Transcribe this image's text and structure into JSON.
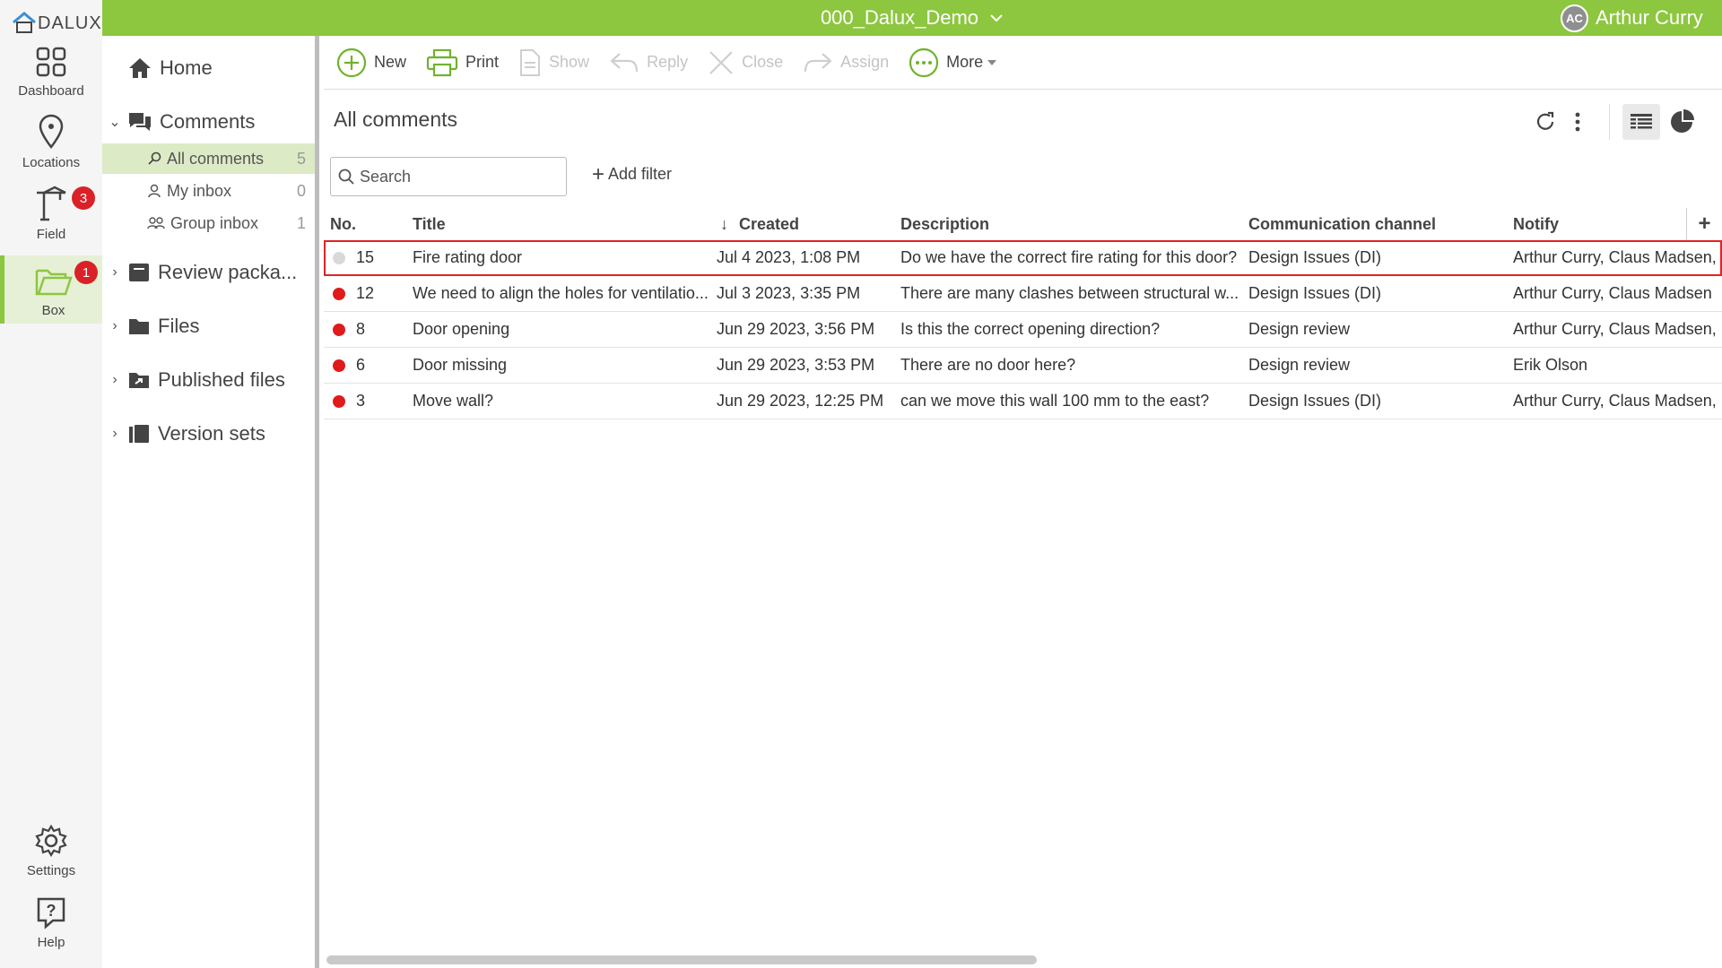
{
  "logo": {
    "text": "DALUX"
  },
  "topbar": {
    "project": "000_Dalux_Demo",
    "user_initials": "AC",
    "user_name": "Arthur Curry"
  },
  "rail": {
    "dashboard": "Dashboard",
    "locations": "Locations",
    "field": "Field",
    "field_badge": "3",
    "box": "Box",
    "box_badge": "1",
    "settings": "Settings",
    "help": "Help"
  },
  "tree": {
    "home": "Home",
    "comments": "Comments",
    "all_comments": "All comments",
    "all_comments_count": "5",
    "my_inbox": "My inbox",
    "my_inbox_count": "0",
    "group_inbox": "Group inbox",
    "group_inbox_count": "1",
    "review": "Review packa...",
    "files": "Files",
    "published": "Published files",
    "version_sets": "Version sets"
  },
  "toolbar": {
    "new": "New",
    "print": "Print",
    "show": "Show",
    "reply": "Reply",
    "close": "Close",
    "assign": "Assign",
    "more": "More"
  },
  "main": {
    "title": "All comments",
    "search_placeholder": "Search",
    "add_filter": "Add filter"
  },
  "table": {
    "headers": {
      "no": "No.",
      "title": "Title",
      "created": "Created",
      "description": "Description",
      "channel": "Communication channel",
      "notify": "Notify",
      "add": "+"
    },
    "rows": [
      {
        "status": "#d9d9d9",
        "no": "15",
        "title": "Fire rating door",
        "created": "Jul 4 2023, 1:08 PM",
        "description": "Do we have the correct fire rating for this door?",
        "channel": "Design Issues (DI)",
        "notify": "Arthur Curry, Claus Madsen, E"
      },
      {
        "status": "#e01b1b",
        "no": "12",
        "title": "We need to align the holes for ventilatio...",
        "created": "Jul 3 2023, 3:35 PM",
        "description": "There are many clashes between structural w...",
        "channel": "Design Issues (DI)",
        "notify": "Arthur Curry, Claus Madsen"
      },
      {
        "status": "#e01b1b",
        "no": "8",
        "title": "Door opening",
        "created": "Jun 29 2023, 3:56 PM",
        "description": "Is this the correct opening direction?",
        "channel": "Design review",
        "notify": "Arthur Curry, Claus Madsen, E"
      },
      {
        "status": "#e01b1b",
        "no": "6",
        "title": "Door missing",
        "created": "Jun 29 2023, 3:53 PM",
        "description": "There are no door here?",
        "channel": "Design review",
        "notify": "Erik Olson"
      },
      {
        "status": "#e01b1b",
        "no": "3",
        "title": "Move wall?",
        "created": "Jun 29 2023, 12:25 PM",
        "description": "can we move this wall 100 mm to the east?",
        "channel": "Design Issues (DI)",
        "notify": "Arthur Curry, Claus Madsen, E"
      }
    ]
  }
}
